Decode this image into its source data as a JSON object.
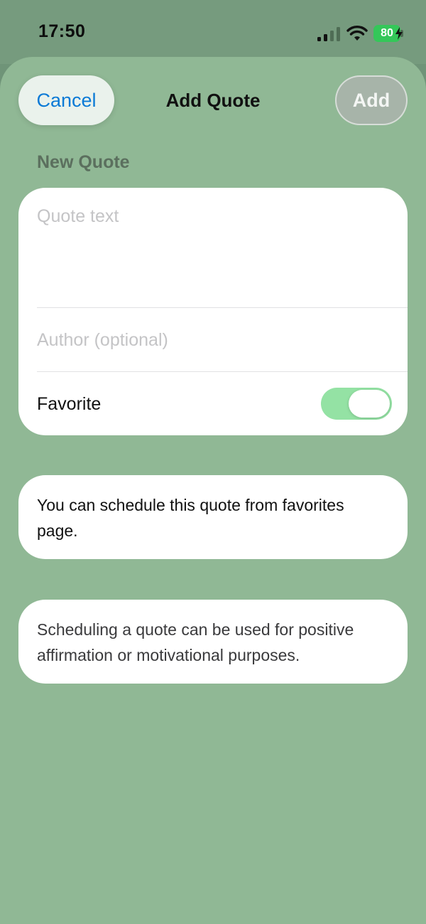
{
  "status_bar": {
    "time": "17:50",
    "battery_level": "80",
    "battery_color": "#34c759",
    "icons": [
      "signal-icon",
      "wifi-icon",
      "battery-icon",
      "bolt-icon"
    ]
  },
  "nav": {
    "cancel_label": "Cancel",
    "title": "Add Quote",
    "add_label": "Add"
  },
  "form": {
    "section_header": "New Quote",
    "quote_placeholder": "Quote text",
    "quote_value": "",
    "author_placeholder": "Author (optional)",
    "author_value": "",
    "favorite_label": "Favorite",
    "favorite_on": true,
    "toggle_color": "#94e2a4"
  },
  "info": {
    "schedule_note": "You can schedule this quote from favorites page.",
    "affirmation_note": "Scheduling a quote can be used for positive affirmation or motivational purposes."
  },
  "colors": {
    "background": "#90b895",
    "accent": "#0a7ad6"
  }
}
